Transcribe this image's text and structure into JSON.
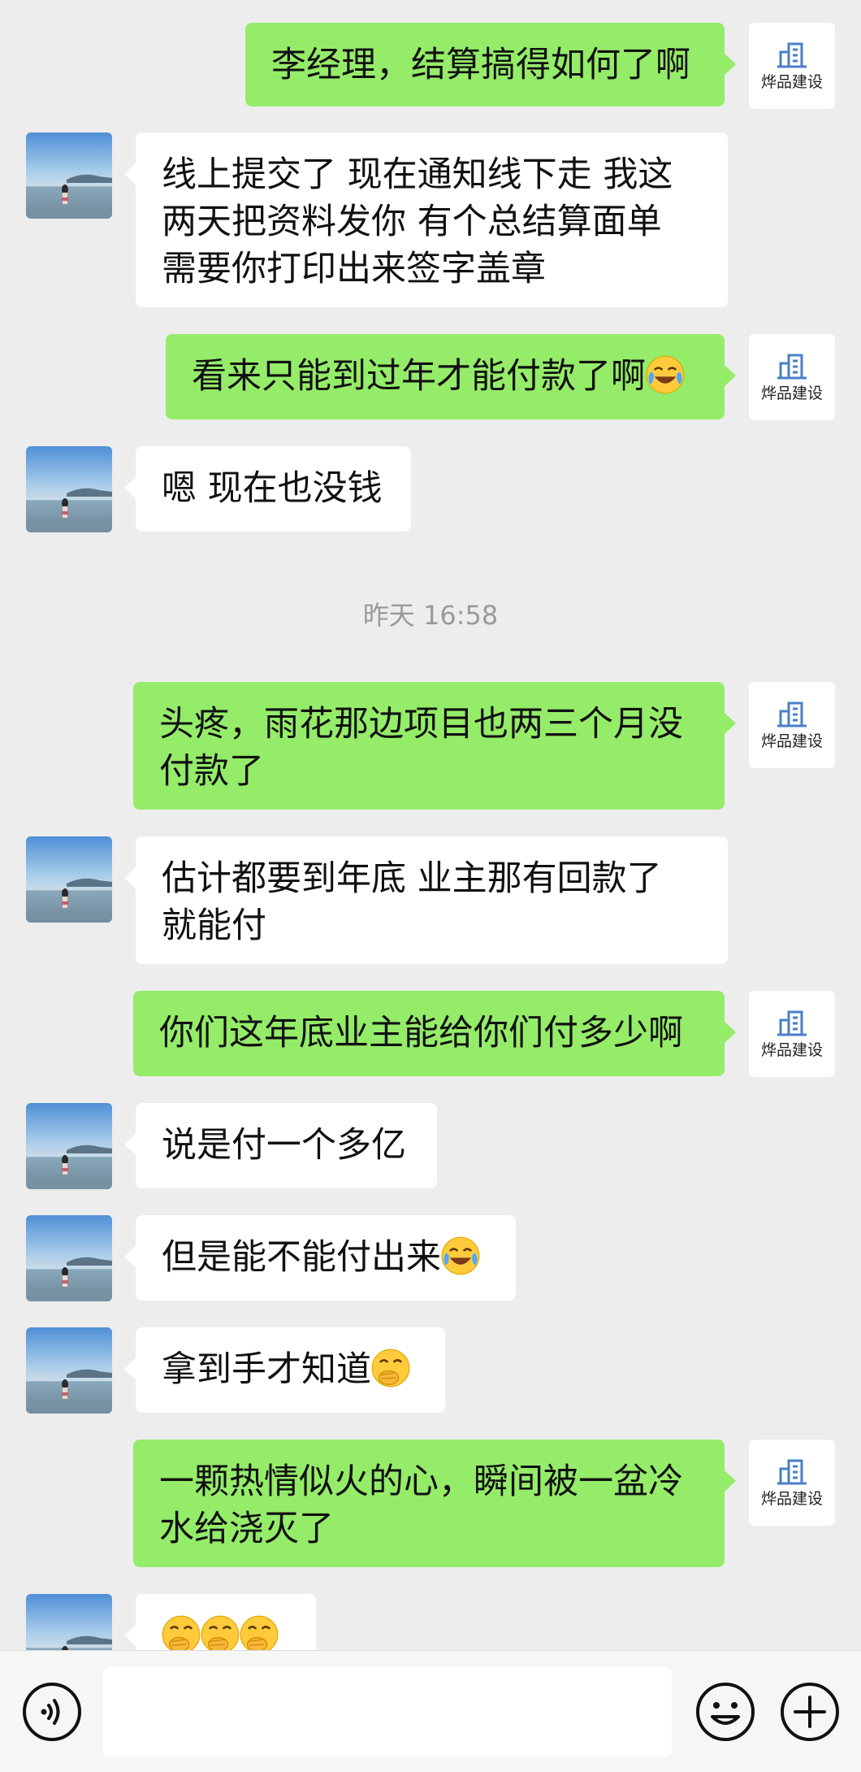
{
  "sender_name": "烨品建设",
  "messages": [
    {
      "side": "right",
      "text": "李经理，结算搞得如何了啊"
    },
    {
      "side": "left",
      "text": "线上提交了 现在通知线下走 我这两天把资料发你 有个总结算面单 需要你打印出来签字盖章"
    },
    {
      "side": "right",
      "text": "看来只能到过年才能付款了啊",
      "emoji": "tears-of-joy-emoji"
    },
    {
      "side": "left",
      "text": "嗯 现在也没钱"
    },
    {
      "side": "right",
      "text": "头疼，雨花那边项目也两三个月没付款了"
    },
    {
      "side": "left",
      "text": "估计都要到年底 业主那有回款了 就能付"
    },
    {
      "side": "right",
      "text": "你们这年底业主能给你们付多少啊"
    },
    {
      "side": "left",
      "text": "说是付一个多亿"
    },
    {
      "side": "left",
      "text": "但是能不能付出来",
      "emoji": "tears-of-joy-emoji"
    },
    {
      "side": "left",
      "text": "拿到手才知道",
      "emoji": "hand-over-mouth-emoji"
    },
    {
      "side": "right",
      "text": "一颗热情似火的心，瞬间被一盆冷水给浇灭了"
    },
    {
      "side": "left",
      "text": "",
      "emoji": "hand-over-mouth-emoji x3"
    }
  ],
  "timestamp": "昨天 16:58",
  "input_bar": {
    "voice_icon": "voice-icon",
    "emoji_icon": "emoji-icon",
    "plus_icon": "plus-icon",
    "value": ""
  },
  "colors": {
    "background": "#ededed",
    "sent_bubble": "#95ec69",
    "received_bubble": "#ffffff",
    "timestamp": "#9a9a9a"
  }
}
